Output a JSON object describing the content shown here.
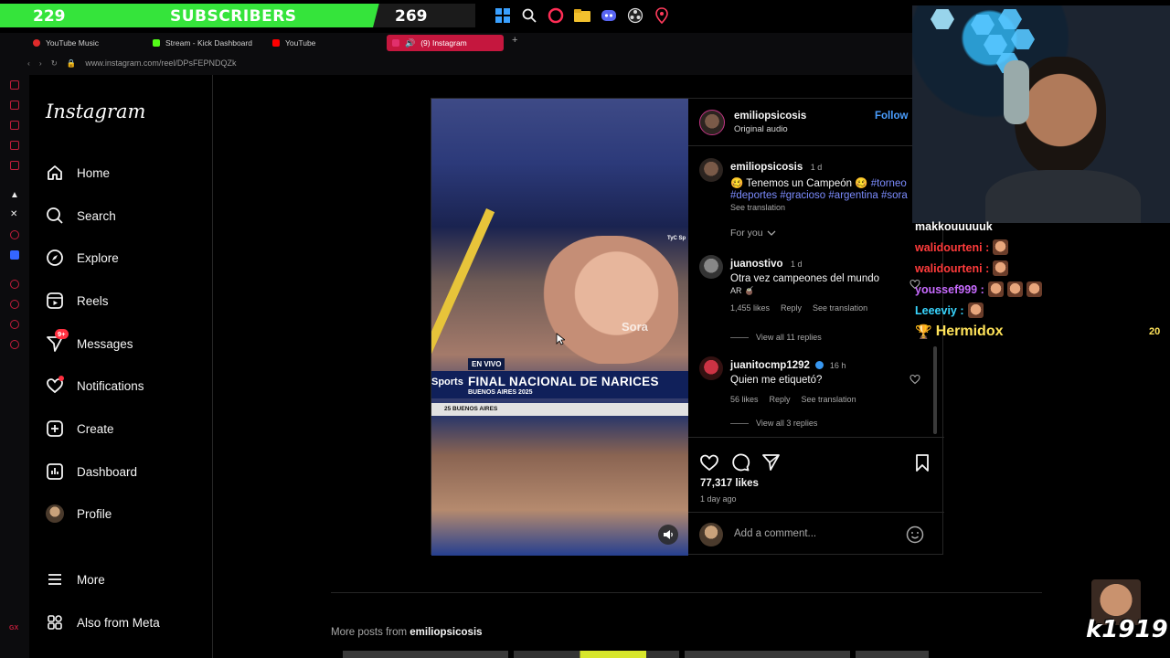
{
  "overlay": {
    "subs_left": "229",
    "subs_label": "SUBSCRIBERS",
    "subs_right": "269"
  },
  "browser": {
    "tabs": [
      {
        "label": "YouTube Music",
        "color": "#e02b2b"
      },
      {
        "label": "Stream - Kick Dashboard",
        "color": "#53fc18"
      },
      {
        "label": "YouTube",
        "color": "#ff0000"
      },
      {
        "label": "(9) Instagram",
        "color": "#e1306c"
      }
    ],
    "new_tab": "+",
    "url": "www.instagram.com/reel/DPsFEPNDQZk"
  },
  "instagram": {
    "logo": "Instagram",
    "nav": [
      {
        "label": "Home",
        "icon": "home-icon"
      },
      {
        "label": "Search",
        "icon": "search-icon"
      },
      {
        "label": "Explore",
        "icon": "compass-icon"
      },
      {
        "label": "Reels",
        "icon": "reels-icon"
      },
      {
        "label": "Messages",
        "icon": "messenger-icon",
        "badge": "9+"
      },
      {
        "label": "Notifications",
        "icon": "heart-icon"
      },
      {
        "label": "Create",
        "icon": "plus-square-icon"
      },
      {
        "label": "Dashboard",
        "icon": "dashboard-icon"
      },
      {
        "label": "Profile",
        "icon": "avatar"
      }
    ],
    "more": "More",
    "also_from_meta": "Also from Meta",
    "post": {
      "author": "emiliopsicosis",
      "audio": "Original audio",
      "follow": "Follow",
      "caption_time": "1 d",
      "caption_text": "🥴 Tenemos un Campeón 🥴",
      "caption_tags_1": "#torneo",
      "caption_tags_2": "#deportes #gracioso #argentina #sora",
      "see_translation": "See translation",
      "for_you": "For you",
      "video_overlay": {
        "en_vivo": "EN VIVO",
        "sports": "Sports",
        "headline": "FINAL NACIONAL DE NARICES",
        "subline": "BUENOS AIRES 2025",
        "strip": "25  BUENOS AIRES",
        "watermark": "Sora",
        "channel": "TyC Sp"
      },
      "comments": [
        {
          "user": "juanostivo",
          "time": "1 d",
          "text": "Otra vez campeones del mundo",
          "text2": "AR 🧉",
          "likes": "1,455 likes",
          "reply": "Reply",
          "translate": "See translation",
          "view_replies": "View all 11 replies"
        },
        {
          "user": "juanitocmp1292",
          "time": "16 h",
          "text": "Quien me etiquetó?",
          "likes": "56 likes",
          "reply": "Reply",
          "translate": "See translation",
          "view_replies": "View all 3 replies"
        }
      ],
      "likes": "77,317 likes",
      "ago": "1 day ago",
      "add_comment": "Add a comment..."
    },
    "more_posts_prefix": "More posts from",
    "more_posts_user": "emiliopsicosis"
  },
  "chat": {
    "messages": [
      {
        "user": "makkouuuuuk",
        "color": "#ffffff",
        "emotes": 0
      },
      {
        "user": "walidourteni :",
        "color": "#ff3b3b",
        "emotes": 1
      },
      {
        "user": "walidourteni :",
        "color": "#ff3b3b",
        "emotes": 1
      },
      {
        "user": "youssef999 :",
        "color": "#c86bff",
        "emotes": 3
      },
      {
        "user": "Leeeviy :",
        "color": "#39d6ff",
        "emotes": 1
      }
    ],
    "highlight_user": "Hermidox",
    "highlight_count": "20"
  },
  "badge_text": "k1919",
  "colors": {
    "accent_green": "#35e43b",
    "ig_link": "#4a9eff",
    "notification": "#ff3040"
  }
}
